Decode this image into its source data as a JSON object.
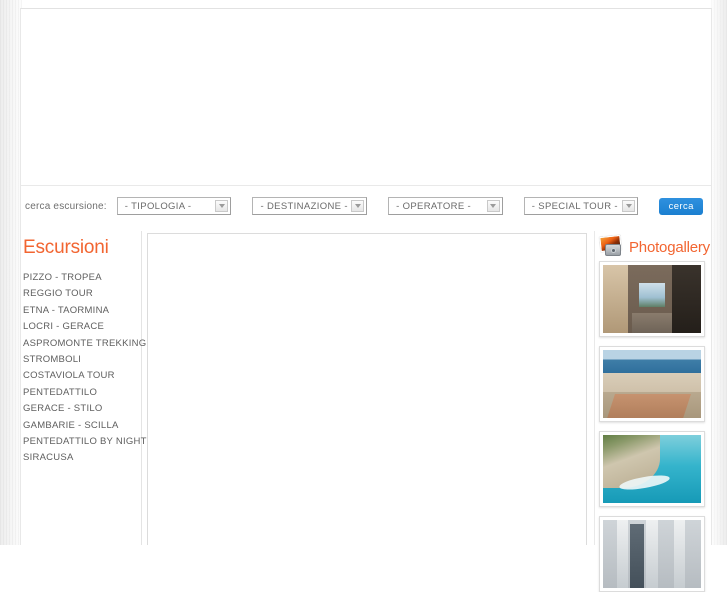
{
  "search": {
    "label": "cerca escursione:",
    "selects": [
      {
        "name": "tipologia",
        "value": "- TIPOLOGIA -"
      },
      {
        "name": "destinazione",
        "value": "- DESTINAZIONE -"
      },
      {
        "name": "operatore",
        "value": "- OPERATORE -"
      },
      {
        "name": "special_tour",
        "value": "- SPECIAL TOUR -"
      }
    ],
    "submit_label": "cerca",
    "submit_color": "#1b7fd0"
  },
  "sidebar": {
    "title": "Escursioni",
    "title_color": "#f26531",
    "items": [
      {
        "label": "PIZZO - TROPEA"
      },
      {
        "label": "REGGIO TOUR"
      },
      {
        "label": "ETNA - TAORMINA"
      },
      {
        "label": "LOCRI - GERACE"
      },
      {
        "label": "ASPROMONTE TREKKING"
      },
      {
        "label": "STROMBOLI"
      },
      {
        "label": "COSTAVIOLA TOUR"
      },
      {
        "label": "PENTEDATTILO"
      },
      {
        "label": "GERACE - STILO"
      },
      {
        "label": "GAMBARIE - SCILLA"
      },
      {
        "label": "PENTEDATTILO BY NIGHT"
      },
      {
        "label": "SIRACUSA"
      }
    ]
  },
  "gallery": {
    "title": "Photogallery",
    "title_color": "#f26531",
    "icon": "photo-camera-icon",
    "thumbnails": [
      {
        "alt": "stone-arch-ruins-thumbnail"
      },
      {
        "alt": "beach-seafront-thumbnail"
      },
      {
        "alt": "turquoise-cliff-coast-thumbnail"
      },
      {
        "alt": "building-architecture-thumbnail"
      }
    ]
  },
  "main": {
    "content": ""
  }
}
